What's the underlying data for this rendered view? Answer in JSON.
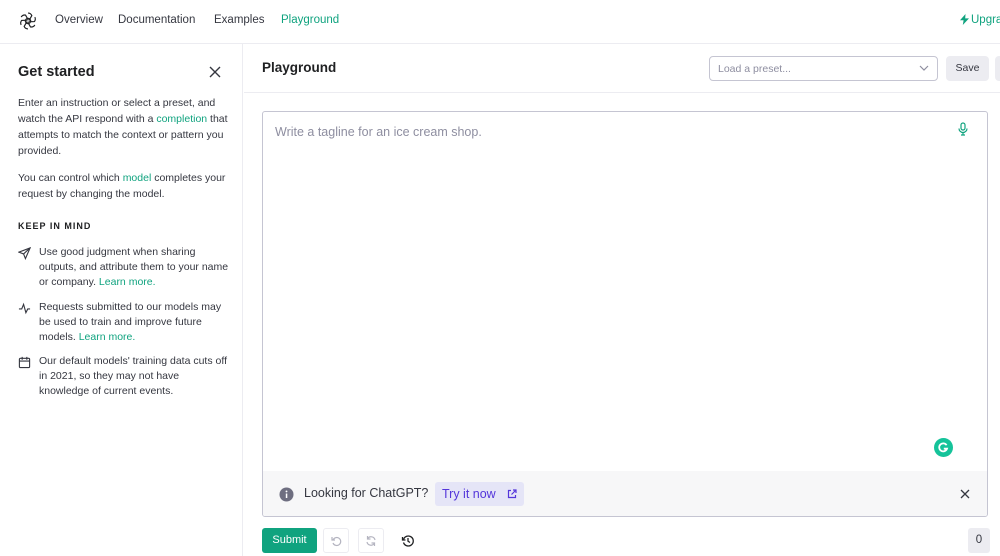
{
  "nav": {
    "links": [
      "Overview",
      "Documentation",
      "Examples",
      "Playground"
    ],
    "upgrade": "Upgra"
  },
  "sidebar": {
    "title": "Get started",
    "intro": {
      "before": "Enter an instruction or select a preset, and watch the API respond with a ",
      "link": "completion",
      "after": " that attempts to match the context or pattern you provided."
    },
    "model_para": {
      "before": "You can control which ",
      "link": "model",
      "after": " completes your request by changing the model."
    },
    "keep_in_mind": "KEEP IN MIND",
    "tips": [
      {
        "icon": "send-icon",
        "text": "Use good judgment when sharing outputs, and attribute them to your name or company. ",
        "link": "Learn more."
      },
      {
        "icon": "activity-icon",
        "text": "Requests submitted to our models may be used to train and improve future models. ",
        "link": "Learn more."
      },
      {
        "icon": "calendar-icon",
        "text": "Our default models' training data cuts off in 2021, so they may not have knowledge of current events.",
        "link": ""
      }
    ]
  },
  "main": {
    "title": "Playground",
    "preset_placeholder": "Load a preset...",
    "save": "Save",
    "editor_placeholder": "Write a tagline for an ice cream shop.",
    "banner": {
      "text": "Looking for ChatGPT?",
      "cta": "Try it now"
    },
    "submit": "Submit",
    "token_count": "0"
  },
  "colors": {
    "accent": "#10a37f",
    "purple": "#5436da",
    "text": "#353740",
    "muted": "#8e8ea0"
  }
}
